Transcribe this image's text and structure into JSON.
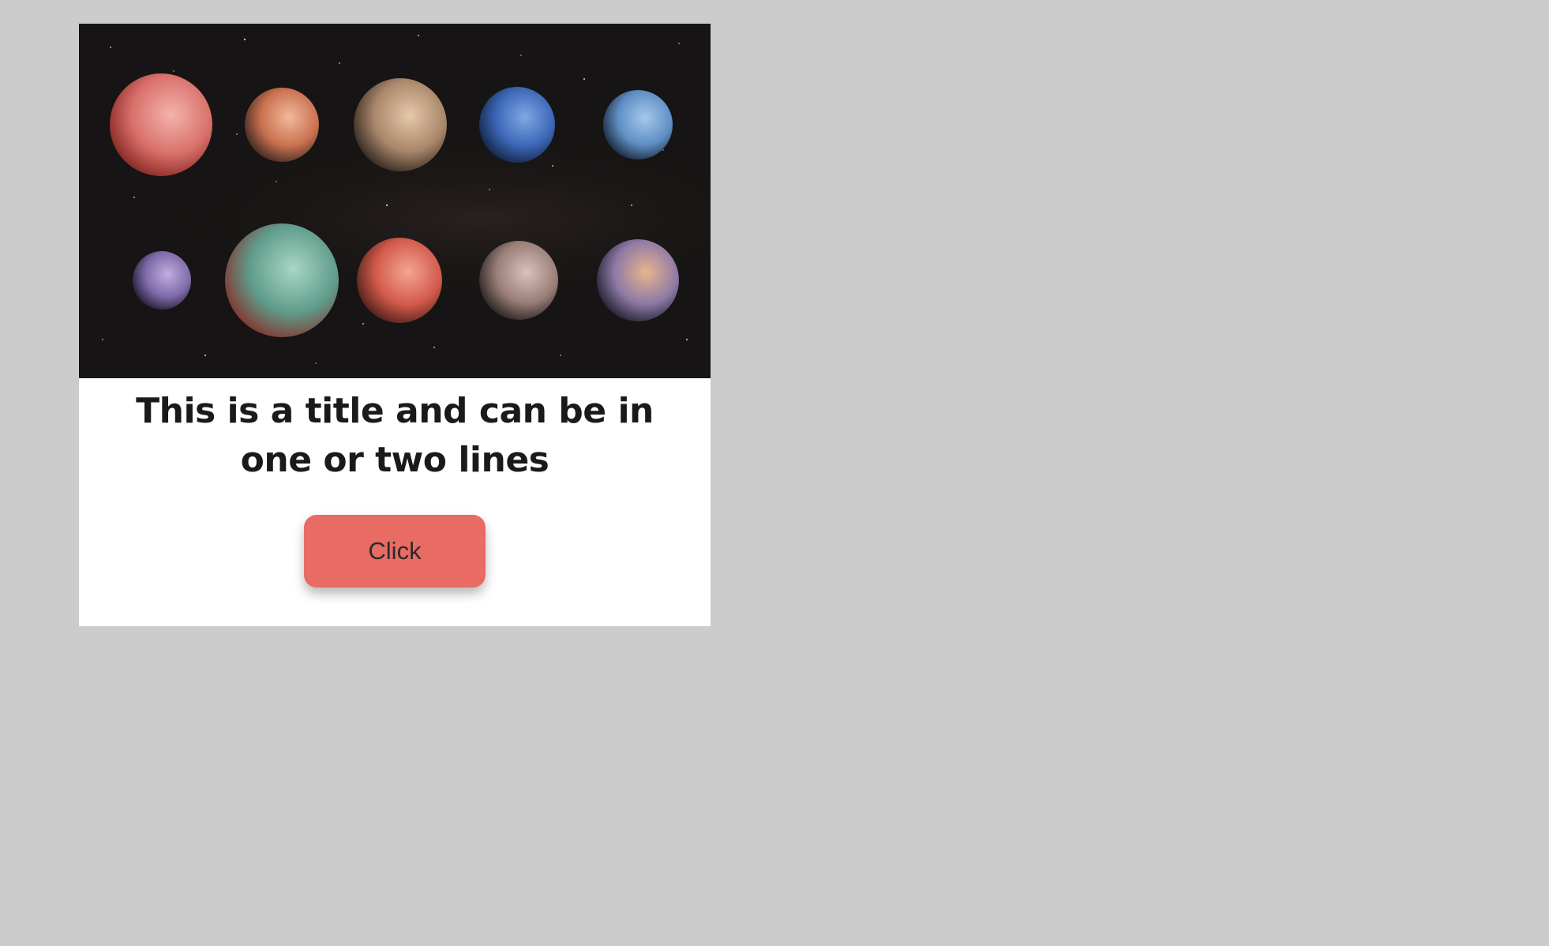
{
  "card": {
    "title": "This is a title and can be in one or two lines",
    "button_label": "Click",
    "button_color": "#e86b64",
    "image": {
      "subject": "exoplanets-illustration"
    }
  }
}
